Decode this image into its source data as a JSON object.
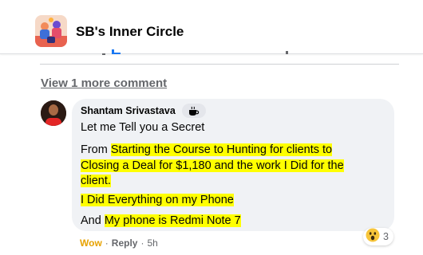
{
  "group": {
    "name": "SB's Inner Circle",
    "avatar_icon": "group-illustration-icon"
  },
  "thread": {
    "view_more": "View 1 more comment"
  },
  "comment": {
    "author": "Shantam Srivastava",
    "author_badge_icon": "coffee-cup-icon",
    "lines": {
      "l1": "Let me Tell you a Secret",
      "l2_pre": "From ",
      "l2_hl": "Starting the Course to Hunting for clients to",
      "l3_hl": "Closing a Deal for $1,180 and the work I Did for the",
      "l4_hl": "client.",
      "l5_hl": "I Did Everything on my Phone",
      "l6_pre": "And ",
      "l6_hl": "My phone is Redmi Note 7"
    },
    "reaction": {
      "icon": "wow-emoji-icon",
      "count": "3"
    },
    "actions": {
      "wow": "Wow",
      "sep": "·",
      "reply": "Reply",
      "time": "5h"
    }
  },
  "colors": {
    "highlight": "#ffff00",
    "wow": "#e7a200",
    "muted": "#65676b"
  }
}
